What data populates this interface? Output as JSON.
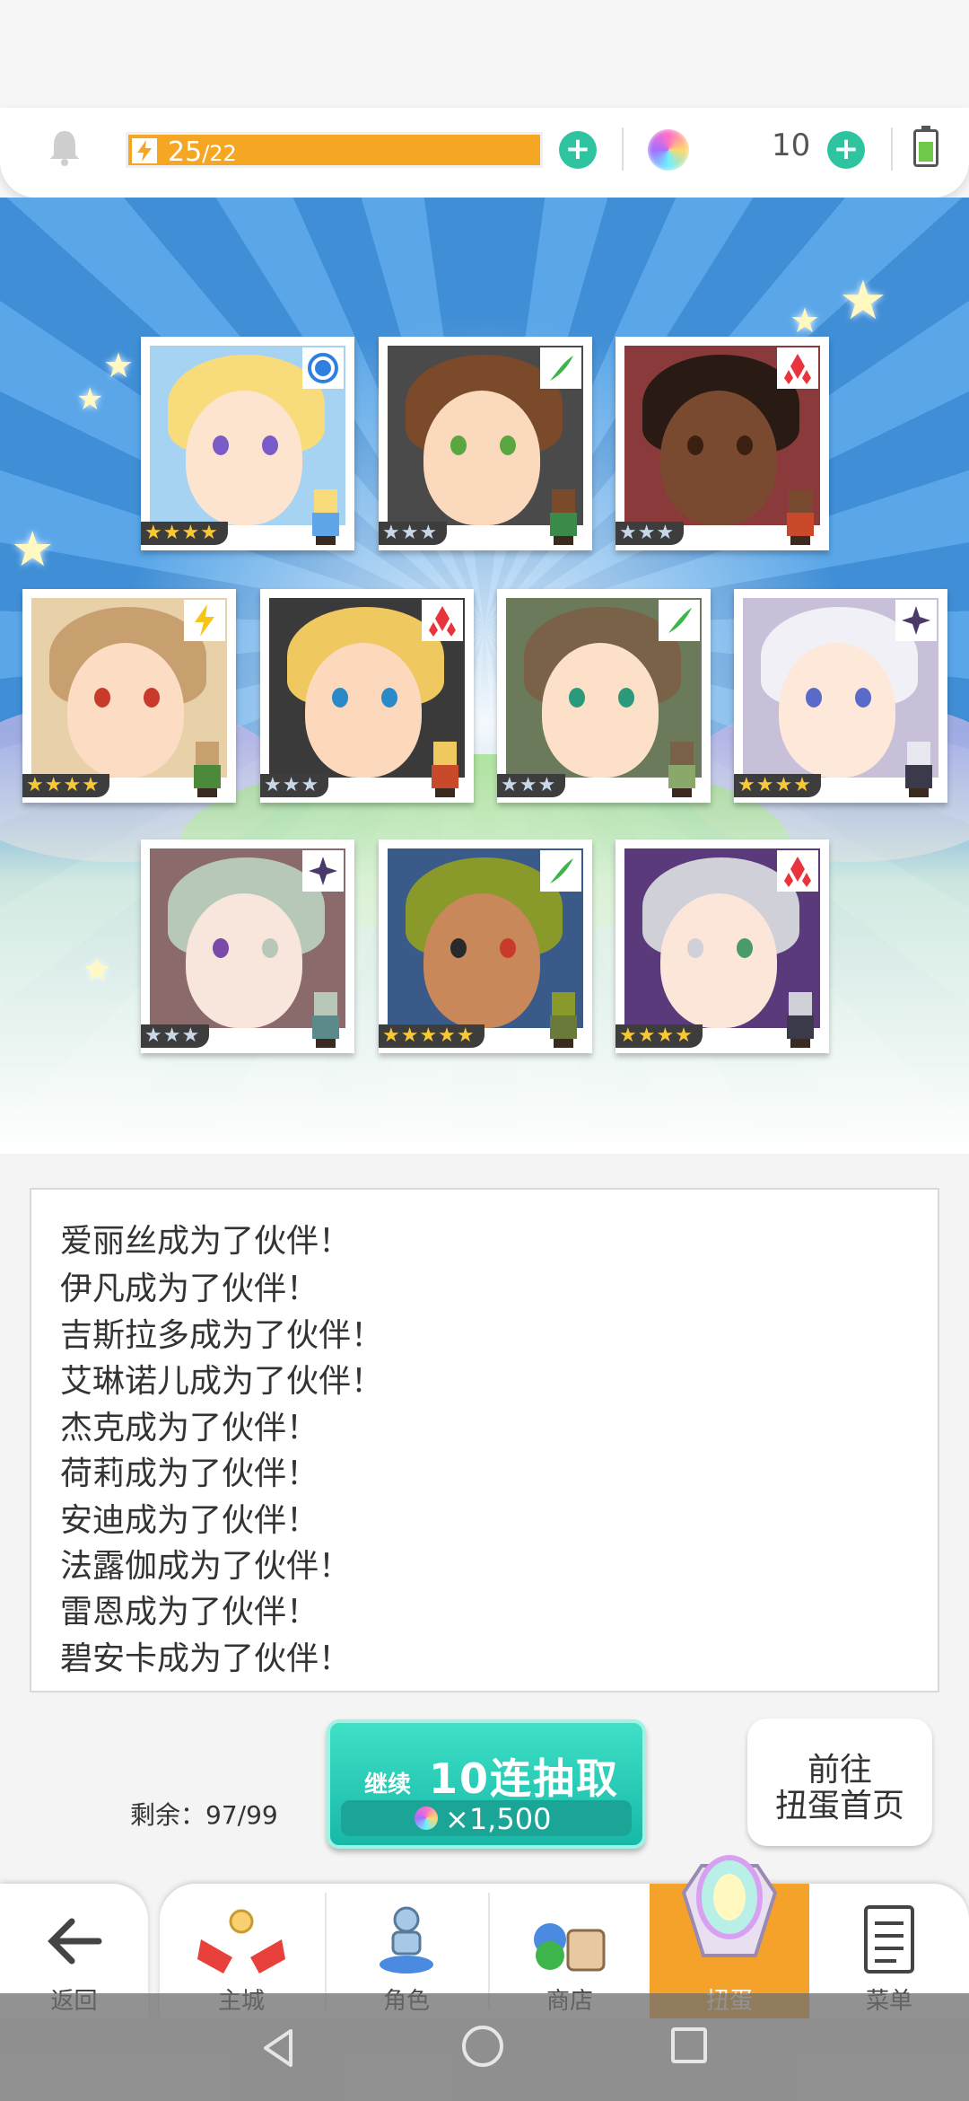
{
  "resources": {
    "stamina_current": "25",
    "stamina_max": "/22",
    "gem_count": "10"
  },
  "heroes": [
    {
      "stars": "★★★★",
      "element": "water",
      "rarity": 4
    },
    {
      "stars": "★★★",
      "element": "wind",
      "rarity": 3
    },
    {
      "stars": "★★★",
      "element": "fire",
      "rarity": 3
    },
    {
      "stars": "★★★★",
      "element": "thunder",
      "rarity": 4
    },
    {
      "stars": "★★★",
      "element": "fire",
      "rarity": 3
    },
    {
      "stars": "★★★",
      "element": "wind",
      "rarity": 3
    },
    {
      "stars": "★★★★",
      "element": "dark",
      "rarity": 4
    },
    {
      "stars": "★★★",
      "element": "dark",
      "rarity": 3
    },
    {
      "stars": "★★★★★",
      "element": "wind",
      "rarity": 5
    },
    {
      "stars": "★★★★",
      "element": "fire",
      "rarity": 4
    }
  ],
  "messages": [
    "爱丽丝成为了伙伴！",
    "伊凡成为了伙伴！",
    "吉斯拉多成为了伙伴！",
    "艾琳诺儿成为了伙伴！",
    "杰克成为了伙伴！",
    "荷莉成为了伙伴！",
    "安迪成为了伙伴！",
    "法露伽成为了伙伴！",
    "雷恩成为了伙伴！",
    "碧安卡成为了伙伴！"
  ],
  "actions": {
    "remaining": "剩余：97/99",
    "continue_label": "继续",
    "pull_label": "10连抽取",
    "pull_cost": "×1,500",
    "goto_line1": "前往",
    "goto_line2": "扭蛋首页"
  },
  "tabs": {
    "back": "返回",
    "main_city": "主城",
    "character": "角色",
    "shop": "商店",
    "gacha": "扭蛋",
    "menu": "菜单"
  },
  "colors": {
    "accent_teal": "#2fc4a0",
    "stamina_orange": "#f5a623",
    "active_tab": "#f5a22b"
  }
}
